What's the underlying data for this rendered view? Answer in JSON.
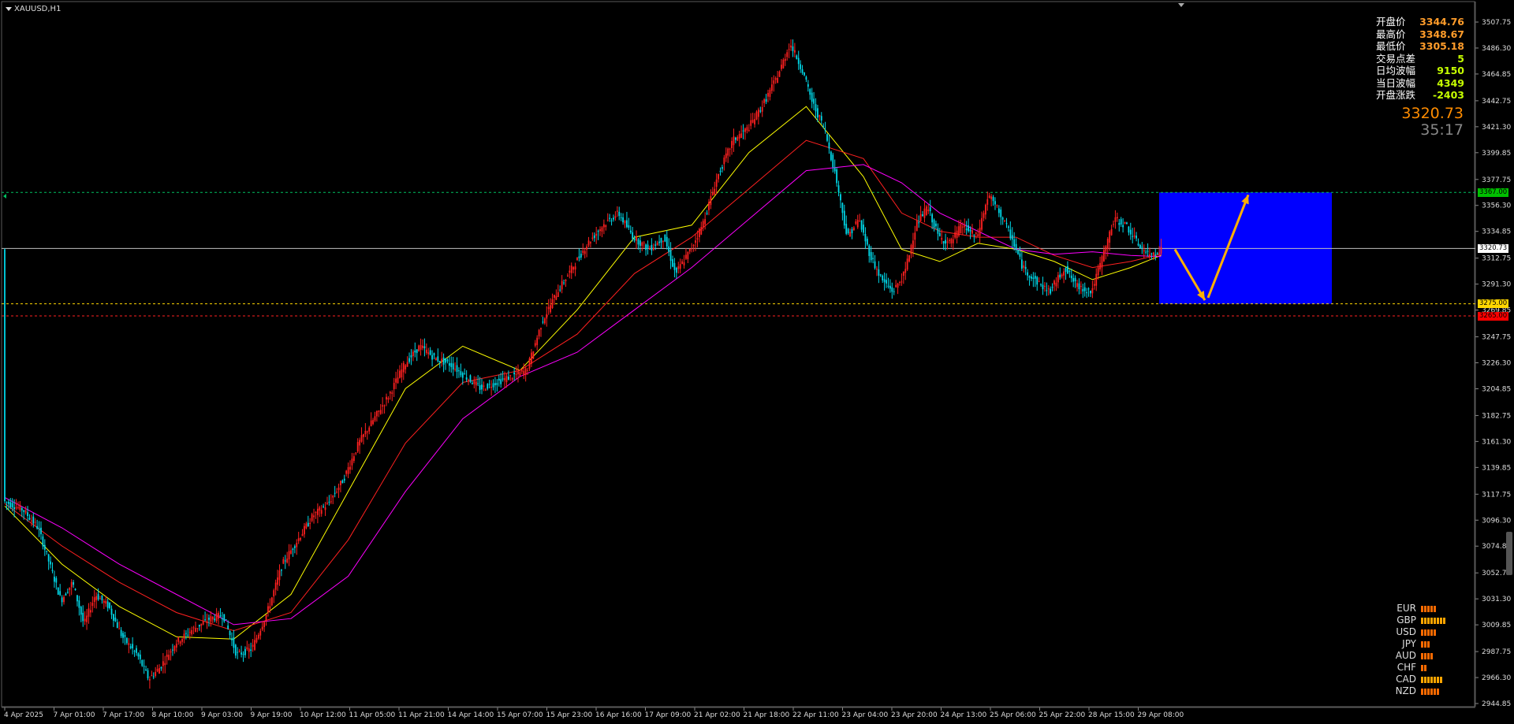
{
  "symbol": "XAUUSD,H1",
  "info_panel": [
    {
      "label": "开盘价",
      "value": "3344.76",
      "color": "#ff9c2a"
    },
    {
      "label": "最高价",
      "value": "3348.67",
      "color": "#ff9c2a"
    },
    {
      "label": "最低价",
      "value": "3305.18",
      "color": "#ff9c2a"
    },
    {
      "label": "交易点差",
      "value": "5",
      "color": "#c6ff00"
    },
    {
      "label": "日均波幅",
      "value": "9150",
      "color": "#c6ff00"
    },
    {
      "label": "当日波幅",
      "value": "4349",
      "color": "#c6ff00"
    },
    {
      "label": "开盘涨跌",
      "value": "-2403",
      "color": "#c6ff00"
    }
  ],
  "current_price": "3320.73",
  "countdown": "35:17",
  "price_tags": [
    {
      "value": "3367.00",
      "price": 3367.0,
      "bg": "#00c000",
      "fg": "#000"
    },
    {
      "value": "3320.73",
      "price": 3320.73,
      "bg": "#ffffff",
      "fg": "#000"
    },
    {
      "value": "3275.00",
      "price": 3275.0,
      "bg": "#ffd700",
      "fg": "#000"
    },
    {
      "value": "3265.00",
      "price": 3265.0,
      "bg": "#ff0000",
      "fg": "#000"
    }
  ],
  "currencies": [
    {
      "name": "EUR",
      "strength": 5,
      "color": "#ff6a00"
    },
    {
      "name": "GBP",
      "strength": 8,
      "color": "#ffa500"
    },
    {
      "name": "USD",
      "strength": 5,
      "color": "#ff6a00"
    },
    {
      "name": "JPY",
      "strength": 3,
      "color": "#ff6a00"
    },
    {
      "name": "AUD",
      "strength": 4,
      "color": "#ff6a00"
    },
    {
      "name": "CHF",
      "strength": 2,
      "color": "#ff6a00"
    },
    {
      "name": "CAD",
      "strength": 7,
      "color": "#ffa500"
    },
    {
      "name": "NZD",
      "strength": 6,
      "color": "#ff6a00"
    }
  ],
  "chart_data": {
    "type": "candlestick",
    "symbol": "XAUUSD",
    "timeframe": "H1",
    "y_ticks": [
      "3507.75",
      "3486.30",
      "3464.85",
      "3442.75",
      "3421.30",
      "3399.85",
      "3377.75",
      "3356.30",
      "3334.85",
      "3312.75",
      "3291.30",
      "3269.85",
      "3247.75",
      "3226.30",
      "3204.85",
      "3182.75",
      "3161.30",
      "3139.85",
      "3117.75",
      "3096.30",
      "3074.85",
      "3052.75",
      "3031.30",
      "3009.85",
      "2987.75",
      "2966.30",
      "2944.85"
    ],
    "x_ticks": [
      "4 Apr 2025",
      "7 Apr 01:00",
      "7 Apr 17:00",
      "8 Apr 10:00",
      "9 Apr 03:00",
      "9 Apr 19:00",
      "10 Apr 12:00",
      "11 Apr 05:00",
      "11 Apr 21:00",
      "14 Apr 14:00",
      "15 Apr 07:00",
      "15 Apr 23:00",
      "16 Apr 16:00",
      "17 Apr 09:00",
      "21 Apr 02:00",
      "21 Apr 18:00",
      "22 Apr 11:00",
      "23 Apr 04:00",
      "23 Apr 20:00",
      "24 Apr 13:00",
      "25 Apr 06:00",
      "25 Apr 22:00",
      "28 Apr 15:00",
      "29 Apr 08:00"
    ],
    "ylim": [
      2944.85,
      3507.75
    ],
    "candle_colors": {
      "up": "#ff2020",
      "down": "#00d8e8"
    },
    "path_points": [
      [
        0,
        3112
      ],
      [
        10,
        3105
      ],
      [
        18,
        3090
      ],
      [
        24,
        3060
      ],
      [
        30,
        3030
      ],
      [
        36,
        3045
      ],
      [
        42,
        3010
      ],
      [
        48,
        3035
      ],
      [
        55,
        3025
      ],
      [
        62,
        3000
      ],
      [
        70,
        2985
      ],
      [
        76,
        2965
      ],
      [
        82,
        2975
      ],
      [
        90,
        2995
      ],
      [
        98,
        3005
      ],
      [
        108,
        3015
      ],
      [
        115,
        3018
      ],
      [
        122,
        2985
      ],
      [
        130,
        2990
      ],
      [
        138,
        3020
      ],
      [
        146,
        3060
      ],
      [
        154,
        3080
      ],
      [
        162,
        3100
      ],
      [
        170,
        3110
      ],
      [
        178,
        3130
      ],
      [
        186,
        3160
      ],
      [
        194,
        3180
      ],
      [
        202,
        3200
      ],
      [
        210,
        3225
      ],
      [
        218,
        3240
      ],
      [
        226,
        3230
      ],
      [
        234,
        3225
      ],
      [
        242,
        3215
      ],
      [
        250,
        3205
      ],
      [
        258,
        3210
      ],
      [
        266,
        3215
      ],
      [
        274,
        3220
      ],
      [
        282,
        3260
      ],
      [
        290,
        3285
      ],
      [
        298,
        3305
      ],
      [
        306,
        3325
      ],
      [
        314,
        3340
      ],
      [
        322,
        3350
      ],
      [
        330,
        3330
      ],
      [
        338,
        3320
      ],
      [
        346,
        3330
      ],
      [
        352,
        3300
      ],
      [
        360,
        3320
      ],
      [
        366,
        3340
      ],
      [
        374,
        3380
      ],
      [
        382,
        3410
      ],
      [
        390,
        3420
      ],
      [
        398,
        3440
      ],
      [
        406,
        3465
      ],
      [
        412,
        3490
      ],
      [
        418,
        3470
      ],
      [
        424,
        3440
      ],
      [
        430,
        3420
      ],
      [
        436,
        3380
      ],
      [
        442,
        3330
      ],
      [
        448,
        3345
      ],
      [
        454,
        3315
      ],
      [
        460,
        3295
      ],
      [
        466,
        3285
      ],
      [
        472,
        3300
      ],
      [
        478,
        3340
      ],
      [
        484,
        3355
      ],
      [
        490,
        3330
      ],
      [
        496,
        3325
      ],
      [
        502,
        3340
      ],
      [
        510,
        3330
      ],
      [
        516,
        3365
      ],
      [
        522,
        3350
      ],
      [
        528,
        3330
      ],
      [
        534,
        3305
      ],
      [
        540,
        3295
      ],
      [
        548,
        3285
      ],
      [
        556,
        3305
      ],
      [
        562,
        3290
      ],
      [
        570,
        3285
      ],
      [
        576,
        3315
      ],
      [
        582,
        3345
      ],
      [
        588,
        3340
      ],
      [
        594,
        3325
      ],
      [
        600,
        3315
      ],
      [
        606,
        3320
      ]
    ],
    "moving_averages": [
      {
        "color": "#ffff00",
        "points": [
          [
            0,
            3108
          ],
          [
            30,
            3060
          ],
          [
            60,
            3025
          ],
          [
            90,
            3000
          ],
          [
            120,
            2998
          ],
          [
            150,
            3035
          ],
          [
            180,
            3120
          ],
          [
            210,
            3205
          ],
          [
            240,
            3240
          ],
          [
            270,
            3220
          ],
          [
            300,
            3270
          ],
          [
            330,
            3330
          ],
          [
            360,
            3340
          ],
          [
            390,
            3400
          ],
          [
            420,
            3438
          ],
          [
            450,
            3380
          ],
          [
            470,
            3320
          ],
          [
            490,
            3310
          ],
          [
            510,
            3325
          ],
          [
            530,
            3320
          ],
          [
            550,
            3310
          ],
          [
            570,
            3295
          ],
          [
            590,
            3305
          ],
          [
            606,
            3315
          ]
        ]
      },
      {
        "color": "#ff2020",
        "points": [
          [
            0,
            3110
          ],
          [
            30,
            3075
          ],
          [
            60,
            3045
          ],
          [
            90,
            3020
          ],
          [
            120,
            3005
          ],
          [
            150,
            3020
          ],
          [
            180,
            3080
          ],
          [
            210,
            3160
          ],
          [
            240,
            3210
          ],
          [
            270,
            3220
          ],
          [
            300,
            3250
          ],
          [
            330,
            3300
          ],
          [
            360,
            3330
          ],
          [
            390,
            3370
          ],
          [
            420,
            3410
          ],
          [
            450,
            3395
          ],
          [
            470,
            3350
          ],
          [
            490,
            3335
          ],
          [
            510,
            3330
          ],
          [
            530,
            3330
          ],
          [
            550,
            3315
          ],
          [
            570,
            3305
          ],
          [
            590,
            3310
          ],
          [
            606,
            3316
          ]
        ]
      },
      {
        "color": "#ff00ff",
        "points": [
          [
            0,
            3115
          ],
          [
            30,
            3090
          ],
          [
            60,
            3060
          ],
          [
            90,
            3035
          ],
          [
            120,
            3010
          ],
          [
            150,
            3015
          ],
          [
            180,
            3050
          ],
          [
            210,
            3120
          ],
          [
            240,
            3180
          ],
          [
            270,
            3215
          ],
          [
            300,
            3235
          ],
          [
            330,
            3270
          ],
          [
            360,
            3305
          ],
          [
            390,
            3345
          ],
          [
            420,
            3385
          ],
          [
            450,
            3390
          ],
          [
            470,
            3375
          ],
          [
            490,
            3350
          ],
          [
            510,
            3335
          ],
          [
            530,
            3320
          ],
          [
            550,
            3316
          ],
          [
            570,
            3318
          ],
          [
            590,
            3315
          ],
          [
            606,
            3314
          ]
        ]
      }
    ],
    "horizontal_levels": [
      {
        "price": 3367.0,
        "color": "#00c060",
        "style": "dashed"
      },
      {
        "price": 3320.73,
        "color": "#c0c0c0",
        "style": "solid"
      },
      {
        "price": 3275.0,
        "color": "#ffd700",
        "style": "dashed"
      },
      {
        "price": 3265.0,
        "color": "#ff2020",
        "style": "dashed"
      }
    ],
    "rectangle": {
      "price_top": 3367.0,
      "price_bottom": 3275.0,
      "color": "#0000ff"
    },
    "arrows": [
      {
        "from_price": 3320.0,
        "to_price": 3278.0,
        "color": "#ffb000"
      },
      {
        "from_price": 3280.0,
        "to_price": 3365.0,
        "color": "#ffb000"
      }
    ]
  }
}
